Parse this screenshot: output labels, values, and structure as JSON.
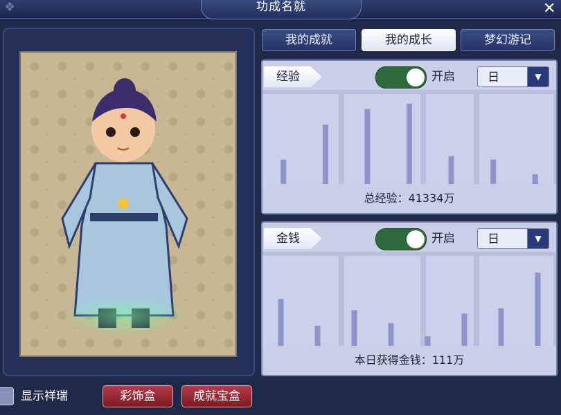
{
  "window": {
    "title": "功成名就"
  },
  "tabs": [
    {
      "label": "我的成就"
    },
    {
      "label": "我的成长"
    },
    {
      "label": "梦幻游记"
    }
  ],
  "panels": [
    {
      "label": "经验",
      "toggle_text": "开启",
      "select_value": "日",
      "footer": "总经验：41334万",
      "chart_data": {
        "type": "bar",
        "values": [
          0.28,
          0.68,
          0.86,
          0.92,
          0.32,
          0.28,
          0.11
        ],
        "ylim": [
          0,
          1
        ]
      }
    },
    {
      "label": "金钱",
      "toggle_text": "开启",
      "select_value": "日",
      "footer": "本日获得金钱：111万",
      "chart_data": {
        "type": "bar",
        "values": [
          0.54,
          0.23,
          0.41,
          0.26,
          0.11,
          0.37,
          0.43,
          0.84
        ],
        "ylim": [
          0,
          1
        ]
      }
    }
  ],
  "bottom": {
    "checkbox_label": "显示祥瑞",
    "btn_cosmetic": "彩饰盒",
    "btn_treasure": "成就宝盒"
  }
}
